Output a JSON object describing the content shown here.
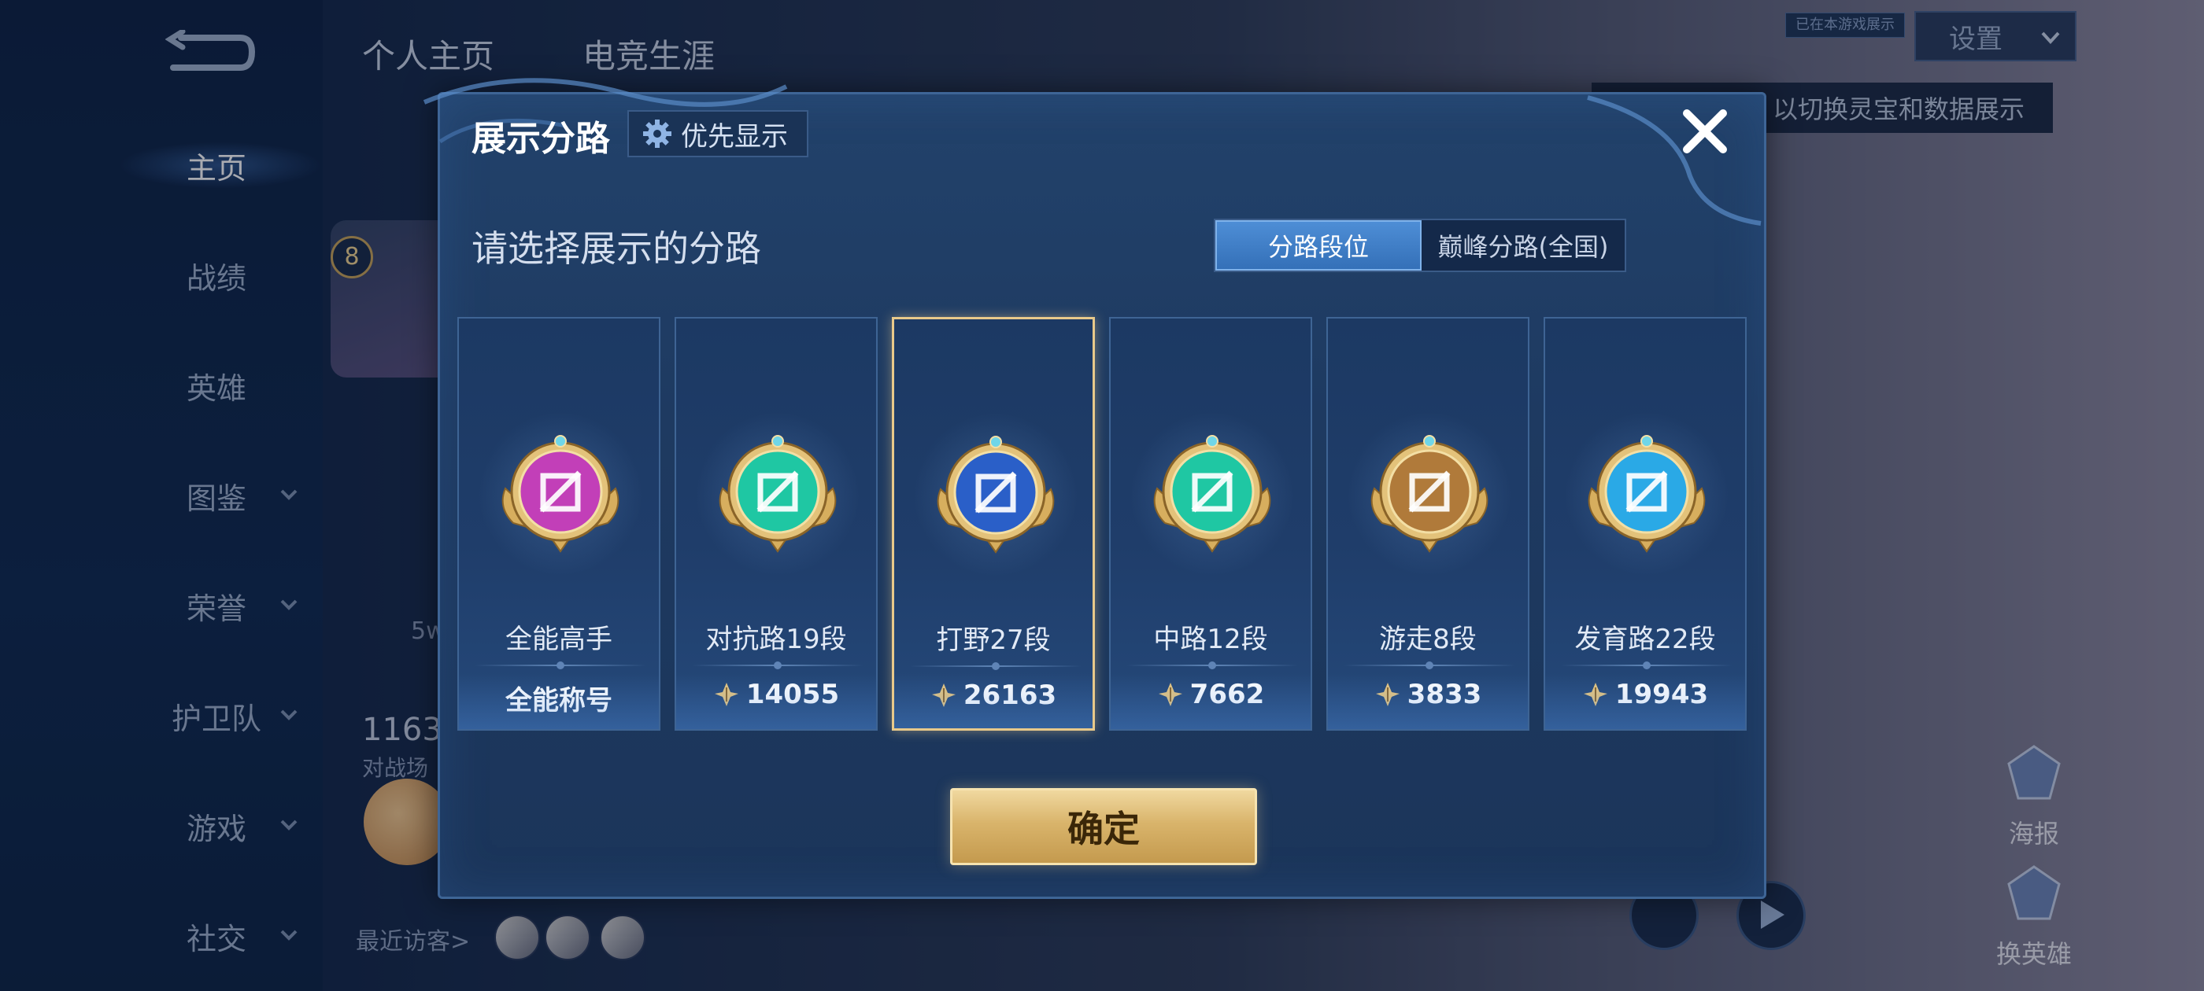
{
  "background": {
    "sidebar": {
      "items": [
        {
          "label": "主页",
          "active": true
        },
        {
          "label": "战绩"
        },
        {
          "label": "英雄"
        },
        {
          "label": "图鉴",
          "expandable": true
        },
        {
          "label": "荣誉",
          "expandable": true
        },
        {
          "label": "护卫队",
          "expandable": true
        },
        {
          "label": "游戏",
          "expandable": true
        },
        {
          "label": "社交",
          "expandable": true
        }
      ]
    },
    "top_tabs": [
      "个人主页",
      "电竞生涯"
    ],
    "level": "8",
    "stat_5w": "5w",
    "stat_number": "1163",
    "stat_label": "对战场",
    "recent_visitors": "最近访客>",
    "settings_dropdown": "设置",
    "mini_tag": "已在本游戏展示",
    "tooltip": "以切换灵宝和数据展示",
    "right_buttons": [
      "海报",
      "换英雄"
    ]
  },
  "modal": {
    "title": "展示分路",
    "priority_button": "优先显示",
    "subtitle": "请选择展示的分路",
    "tabs": [
      {
        "label": "分路段位",
        "active": true
      },
      {
        "label": "巅峰分路(全国)",
        "active": false
      }
    ],
    "cards": [
      {
        "title": "全能高手",
        "score": "全能称号",
        "has_points_icon": false,
        "emblem": "all-round-emblem-icon",
        "color": "#c23fb8",
        "selected": false
      },
      {
        "title": "对抗路19段",
        "score": "14055",
        "has_points_icon": true,
        "emblem": "clash-lane-emblem-icon",
        "color": "#1fc7a3",
        "selected": false
      },
      {
        "title": "打野27段",
        "score": "26163",
        "has_points_icon": true,
        "emblem": "jungle-emblem-icon",
        "color": "#2a5fc8",
        "selected": true
      },
      {
        "title": "中路12段",
        "score": "7662",
        "has_points_icon": true,
        "emblem": "mid-lane-emblem-icon",
        "color": "#1fc7a3",
        "selected": false
      },
      {
        "title": "游走8段",
        "score": "3833",
        "has_points_icon": true,
        "emblem": "roam-emblem-icon",
        "color": "#b07a3a",
        "selected": false
      },
      {
        "title": "发育路22段",
        "score": "19943",
        "has_points_icon": true,
        "emblem": "farm-lane-emblem-icon",
        "color": "#2aa9e6",
        "selected": false
      }
    ],
    "confirm_button": "确定"
  }
}
